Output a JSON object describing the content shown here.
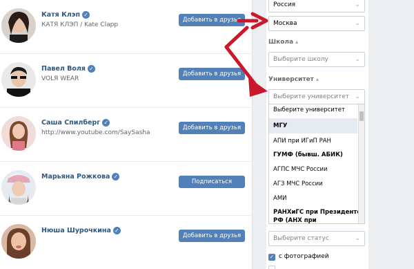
{
  "people": [
    {
      "name": "Катя Клэп",
      "subtitle": "КАТЯ КЛЭП / Kate Clapp",
      "action": "Добавить в друзья",
      "verified": true
    },
    {
      "name": "Павел Воля",
      "subtitle": "VOLЯ WEAR",
      "action": "Добавить в друзья",
      "verified": true
    },
    {
      "name": "Саша Спилберг",
      "subtitle": "http://www.youtube.com/SaySasha",
      "action": "Добавить в друзья",
      "verified": true
    },
    {
      "name": "Марьяна Рожкова",
      "subtitle": "",
      "action": "Подписаться",
      "verified": true
    },
    {
      "name": "Нюша Шурочкина",
      "subtitle": "",
      "action": "Добавить в друзья",
      "verified": true
    }
  ],
  "verified_mark": "✓",
  "filters": {
    "country": "Россия",
    "city": "Москва",
    "school_label": "Школа",
    "school_placeholder": "Выберите школу",
    "university_label": "Университет",
    "university_placeholder": "Выберите университет",
    "university_options": [
      "Выберите университет",
      "МГУ",
      "АПИ при ИГиП РАН",
      "ГУМФ (бывш. АБИК)",
      "АГПС МЧС России",
      "АГЗ МЧС России",
      "АМИ",
      "РАНХиГС при Президенте",
      "РФ (АНХ при"
    ],
    "status_placeholder": "Выберите статус",
    "with_photo_label": "с фотографией",
    "with_photo_checked": true
  },
  "colors": {
    "accent": "#5181b8",
    "link": "#2a5885",
    "arrow": "#c9182b"
  }
}
